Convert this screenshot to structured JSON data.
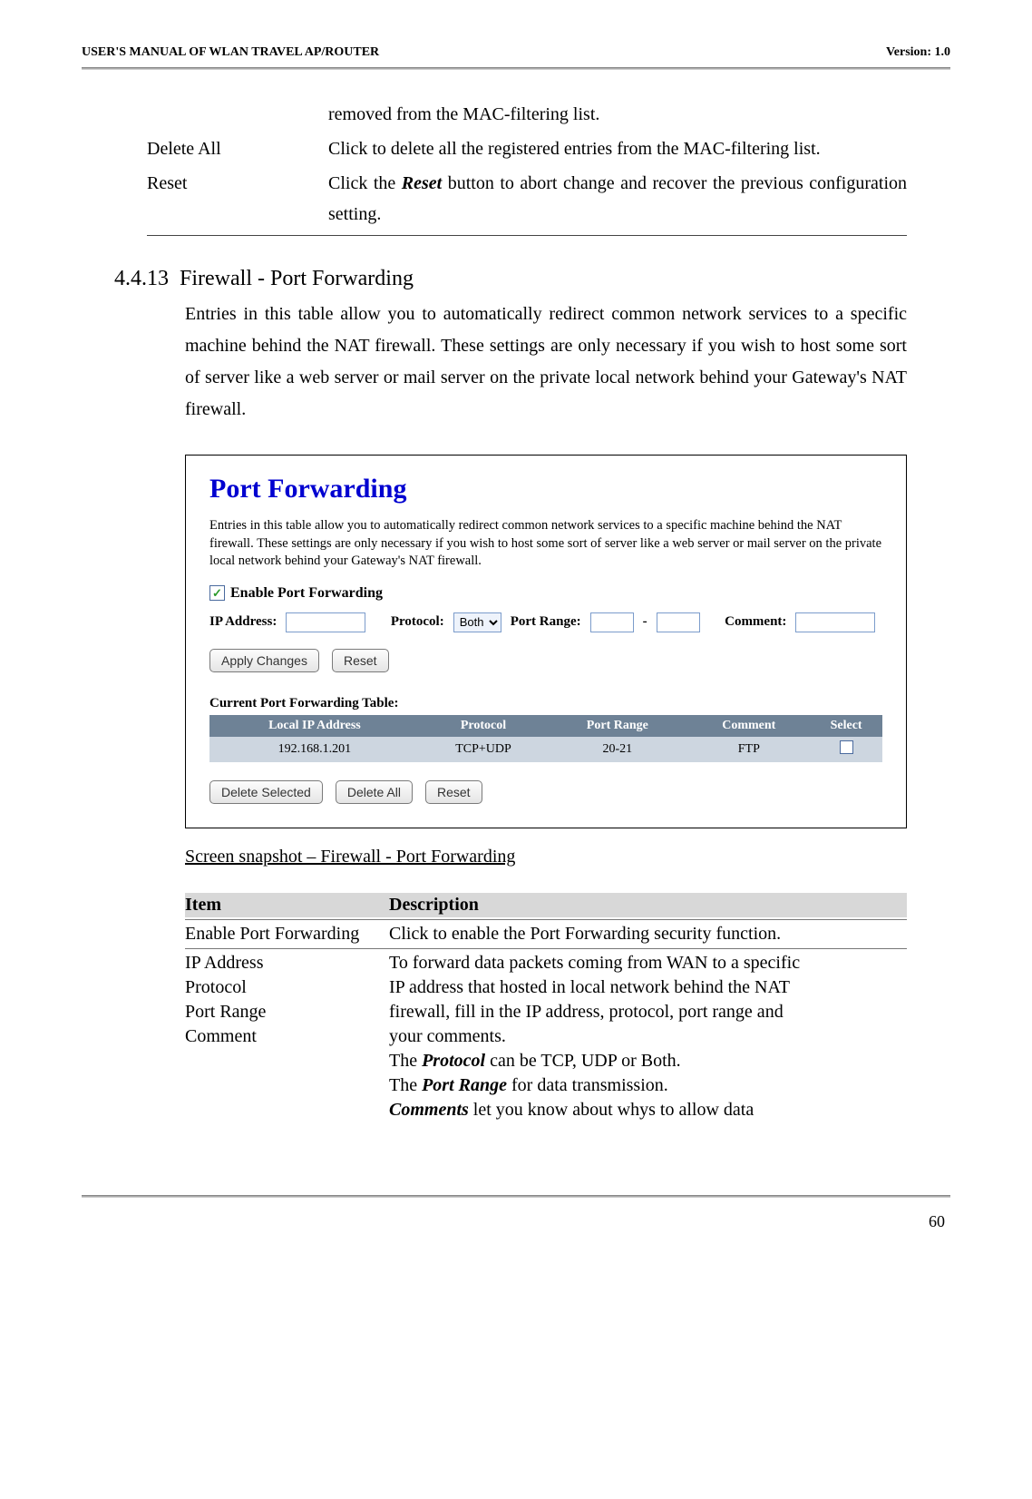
{
  "header": {
    "left": "USER'S MANUAL OF WLAN TRAVEL AP/ROUTER",
    "right": "Version: 1.0"
  },
  "top_table": {
    "removed_line": "removed from the MAC-filtering list.",
    "rows": [
      {
        "term": "Delete All",
        "def": "Click to delete all the registered entries from the MAC-filtering list."
      },
      {
        "term": "Reset",
        "def_pre": "Click the ",
        "def_bold": "Reset",
        "def_post": " button to abort change and recover the previous configuration setting."
      }
    ]
  },
  "section": {
    "num": "4.4.13",
    "title": "Firewall - Port Forwarding",
    "body": "Entries in this table allow you to automatically redirect common network services to a specific machine behind the NAT firewall. These settings are only necessary if you wish to host some sort of server like a web server or mail server on the private local network behind your Gateway's NAT firewall."
  },
  "box": {
    "title": "Port Forwarding",
    "desc": "Entries in this table allow you to automatically redirect common network services to a specific machine behind the NAT firewall. These settings are only necessary if you wish to host some sort of server like a web server or mail server on the private local network behind your Gateway's NAT firewall.",
    "checkbox_label": "Enable Port Forwarding",
    "labels": {
      "ip": "IP Address:",
      "protocol": "Protocol:",
      "port_range": "Port Range:",
      "comment": "Comment:"
    },
    "protocol_value": "Both",
    "buttons": {
      "apply": "Apply Changes",
      "reset": "Reset",
      "del_sel": "Delete Selected",
      "del_all": "Delete All",
      "reset2": "Reset"
    },
    "table_caption": "Current Port Forwarding Table:",
    "table_headers": [
      "Local IP Address",
      "Protocol",
      "Port Range",
      "Comment",
      "Select"
    ],
    "table_row": [
      "192.168.1.201",
      "TCP+UDP",
      "20-21",
      "FTP"
    ]
  },
  "snapshot_caption": "Screen snapshot – Firewall - Port Forwarding",
  "items": {
    "headers": [
      "Item",
      "Description"
    ],
    "r1": {
      "term": "Enable Port Forwarding",
      "def": "Click to enable the Port Forwarding security function."
    },
    "group": {
      "terms": [
        "IP Address",
        "Protocol",
        "Port Range",
        "Comment"
      ],
      "def_lines": [
        "To forward data packets coming from WAN to a specific",
        "IP address that hosted in local network behind the NAT",
        "firewall, fill in the IP address, protocol, port range and",
        "your comments."
      ],
      "extra": [
        {
          "pre": "The ",
          "bold": "Protocol",
          "post": " can be TCP, UDP or Both."
        },
        {
          "pre": "The ",
          "bold": "Port Range",
          "post": " for data transmission."
        },
        {
          "pre": "",
          "bold": "Comments",
          "post": " let you know about whys to allow data"
        }
      ]
    }
  },
  "page_num": "60"
}
